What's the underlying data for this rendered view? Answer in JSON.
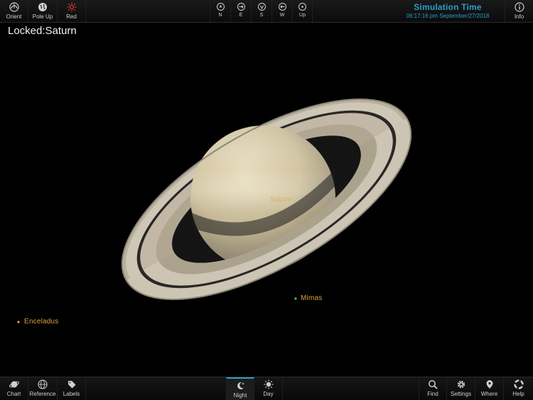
{
  "toolbar_top": {
    "orient_label": "Orient",
    "pole_up_label": "Pole Up",
    "red_label": "Red",
    "compass": [
      "N",
      "E",
      "S",
      "W",
      "Up"
    ],
    "simulation_title": "Simulation Time",
    "simulation_datetime": "06:17:16 pm September/27/2018",
    "info_label": "Info"
  },
  "view": {
    "locked_label": "Locked:Saturn",
    "planet_label": "Saturn",
    "moons": [
      {
        "name": "Mimas",
        "color": "#4cc05a"
      },
      {
        "name": "Enceladus",
        "color": "#e0a040"
      }
    ]
  },
  "toolbar_bottom": {
    "chart_label": "Chart",
    "reference_label": "Reference",
    "labels_label": "Labels",
    "night_label": "Night",
    "day_label": "Day",
    "find_label": "Find",
    "settings_label": "Settings",
    "where_label": "Where",
    "help_label": "Help"
  },
  "colors": {
    "accent": "#2a9ec8",
    "moon_label": "#e0a040"
  }
}
